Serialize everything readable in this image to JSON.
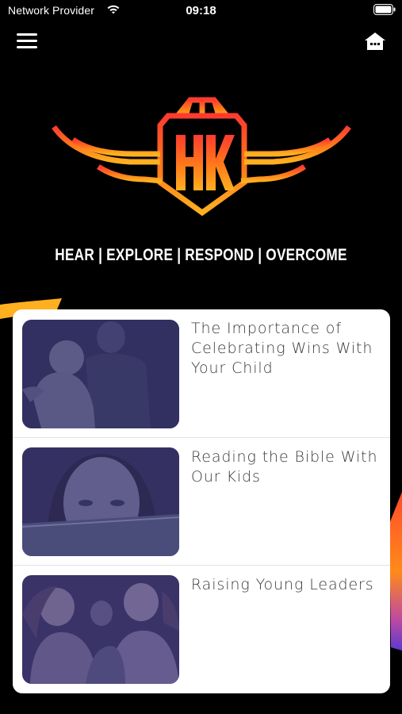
{
  "status_bar": {
    "carrier": "Network Provider",
    "time": "09:18"
  },
  "icons": {
    "menu": "hamburger-menu-icon",
    "home": "home-icon",
    "wifi": "wifi-icon",
    "battery": "battery-icon"
  },
  "logo": {
    "text": "HK",
    "colors": [
      "#ff3b2f",
      "#ff7a1a",
      "#ffb020"
    ]
  },
  "tagline": "HEAR | EXPLORE | RESPOND | OVERCOME",
  "articles": [
    {
      "title": "The Importance of Celebrating Wins With Your Child"
    },
    {
      "title": "Reading the Bible With Our Kids"
    },
    {
      "title": "Raising Young Leaders"
    }
  ]
}
